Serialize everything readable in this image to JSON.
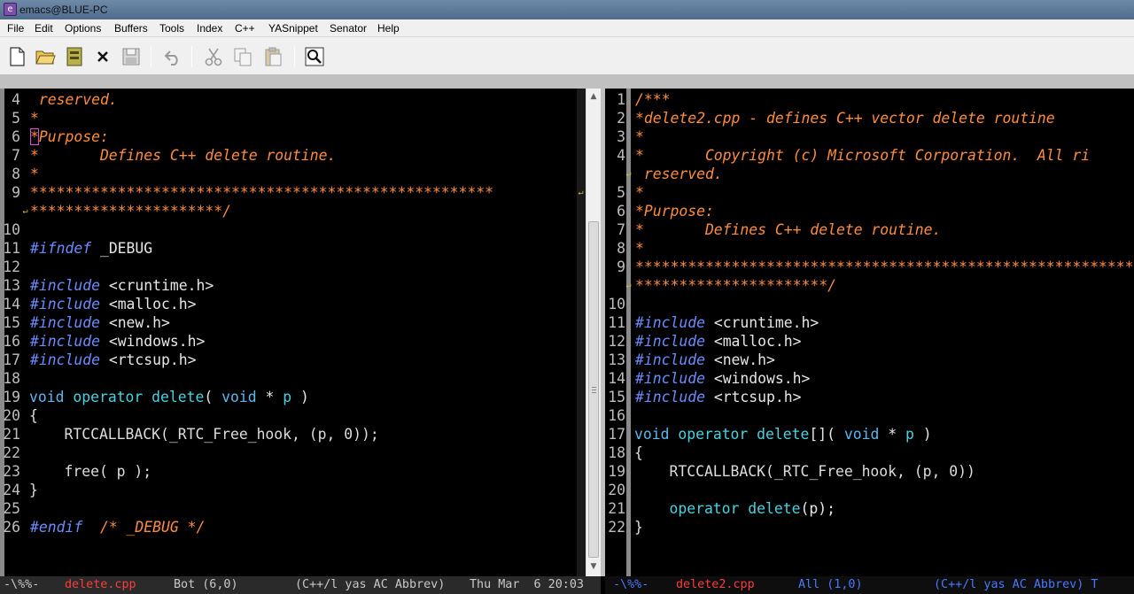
{
  "window": {
    "title": "emacs@BLUE-PC"
  },
  "menubar": {
    "items": [
      "File",
      "Edit",
      "Options",
      "Buffers",
      "Tools",
      "Index",
      "C++",
      "YASnippet",
      "Senator",
      "Help"
    ]
  },
  "toolbar": {
    "buttons": [
      "new-file-icon",
      "open-folder-icon",
      "dired-icon",
      "close-icon",
      "save-icon",
      "undo-icon",
      "cut-icon",
      "copy-icon",
      "paste-icon",
      "search-icon"
    ]
  },
  "left_pane": {
    "line_numbers": [
      "",
      "4",
      "5",
      "6",
      "7",
      "8",
      "9",
      "",
      "10",
      "11",
      "12",
      "13",
      "14",
      "15",
      "16",
      "17",
      "18",
      "19",
      "20",
      "21",
      "22",
      "23",
      "24",
      "25",
      "26"
    ],
    "lines": {
      "l0_comment": "*",
      "l4_comment": " reserved.",
      "l5_comment": "*",
      "l6_comment": "*Purpose:",
      "l7_comment": "*       Defines C++ delete routine.",
      "l8_comment": "*",
      "l9_comment": "*****************************************************",
      "l9b_comment": "**********************/",
      "l11_pre": "#ifndef",
      "l11_id": " _DEBUG",
      "l13_pre": "#include",
      "l13_id": " <cruntime.h>",
      "l14_pre": "#include",
      "l14_id": " <malloc.h>",
      "l15_pre": "#include",
      "l15_id": " <new.h>",
      "l16_pre": "#include",
      "l16_id": " <windows.h>",
      "l17_pre": "#include",
      "l17_id": " <rtcsup.h>",
      "l19_kw": "void",
      "l19_fn": " operator delete",
      "l19_rest": "( ",
      "l19_type": "void",
      "l19_star": " * ",
      "l19_p": "p",
      "l19_close": " )",
      "l20": "{",
      "l21": "    RTCCALLBACK(_RTC_Free_hook, (p, 0));",
      "l23": "    free( p );",
      "l24": "}",
      "l26_pre": "#endif",
      "l26_comment": "  /* _DEBUG */"
    }
  },
  "right_pane": {
    "line_numbers": [
      "1",
      "2",
      "3",
      "4",
      "",
      "5",
      "6",
      "7",
      "8",
      "9",
      "",
      "10",
      "11",
      "12",
      "13",
      "14",
      "15",
      "16",
      "17",
      "18",
      "19",
      "20",
      "21",
      "22"
    ],
    "lines": {
      "r1": "/***",
      "r2": "*delete2.cpp - defines C++ vector delete routine",
      "r3": "*",
      "r4": "*       Copyright (c) Microsoft Corporation.  All ri",
      "r4b": " reserved.",
      "r5": "*",
      "r6": "*Purpose:",
      "r7": "*       Defines C++ delete routine.",
      "r8": "*",
      "r9": "*********************************************************",
      "r9b": "**********************/",
      "r11_pre": "#include",
      "r11_id": " <cruntime.h>",
      "r12_pre": "#include",
      "r12_id": " <malloc.h>",
      "r13_pre": "#include",
      "r13_id": " <new.h>",
      "r14_pre": "#include",
      "r14_id": " <windows.h>",
      "r15_pre": "#include",
      "r15_id": " <rtcsup.h>",
      "r17_kw": "void",
      "r17_fn": " operator delete",
      "r17_rest": "[]( ",
      "r17_type": "void",
      "r17_star": " * ",
      "r17_p": "p",
      "r17_close": " )",
      "r18": "{",
      "r19": "    RTCCALLBACK(_RTC_Free_hook, (p, 0))",
      "r21_fn": "    operator delete",
      "r21_rest": "(p);",
      "r22": "}"
    }
  },
  "modeline_left": {
    "status": "-\\%%-",
    "buffer": "delete.cpp",
    "position": "Bot (6,0)",
    "modes": "(C++/l yas AC Abbrev)",
    "time": "Thu Mar  6 20:03"
  },
  "modeline_right": {
    "status": "-\\%%-",
    "buffer": "delete2.cpp",
    "position": "All (1,0)",
    "modes": "(C++/l yas AC Abbrev) T"
  },
  "colors": {
    "comment": "#ff8c3a",
    "preprocessor": "#6b8cff",
    "keyword": "#59b8f0",
    "function": "#47d2e0",
    "buffer_name": "#ff3b3b"
  }
}
